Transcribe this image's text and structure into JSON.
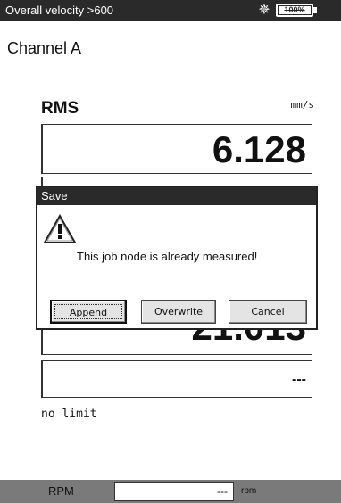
{
  "titlebar": {
    "title": "Overall velocity >600",
    "battery_icon": "battery-icon",
    "battery_text": "100%",
    "status_icon": "bug-icon"
  },
  "channel": "Channel A",
  "measure": {
    "label": "RMS",
    "unit": "mm/s",
    "value": "6.128",
    "second_value": "21.013",
    "third_value": "---",
    "limit": "no limit"
  },
  "dialog": {
    "title": "Save",
    "icon": "warning-icon",
    "message": "This job node is already measured!",
    "buttons": {
      "append": "Append",
      "overwrite": "Overwrite",
      "cancel": "Cancel"
    }
  },
  "footer": {
    "label": "RPM",
    "value": "---",
    "unit": "rpm"
  }
}
